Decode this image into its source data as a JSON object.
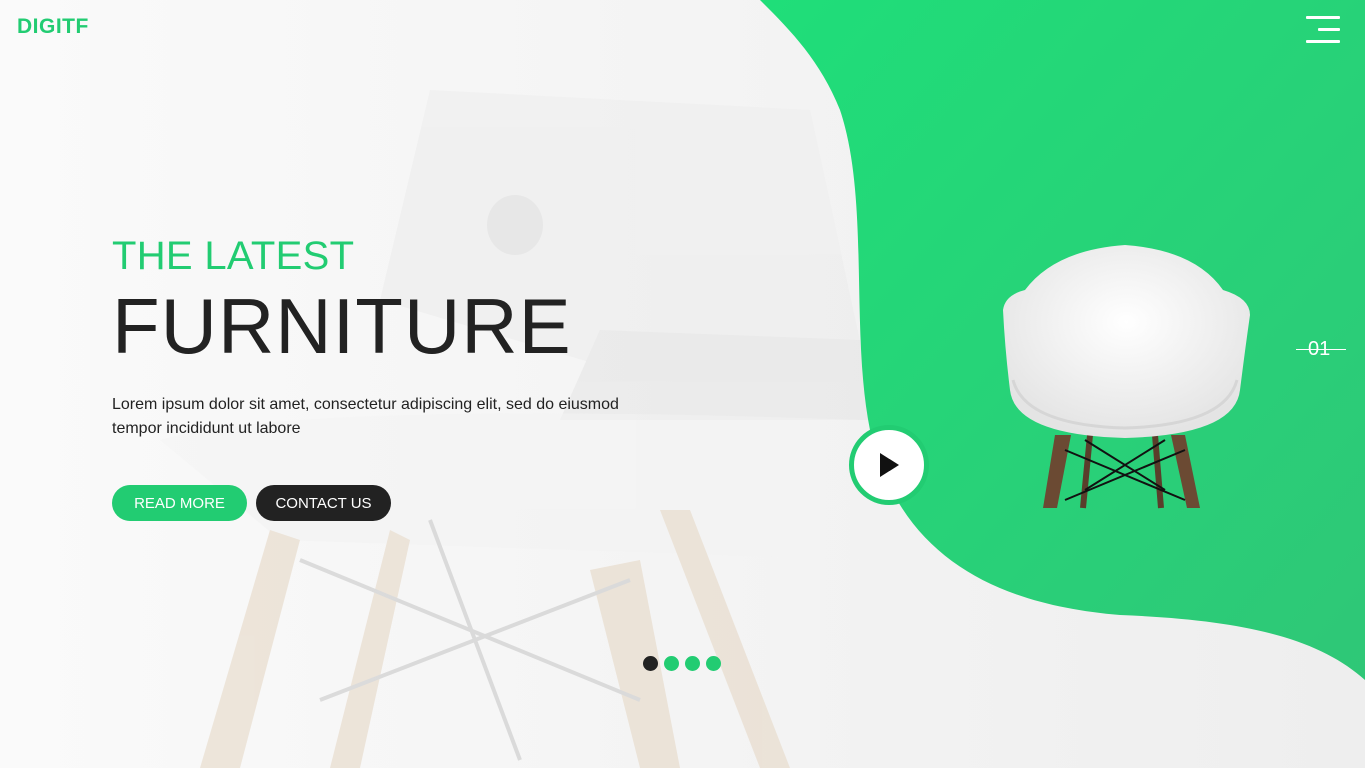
{
  "brand": {
    "logo": "DIGITF"
  },
  "hero": {
    "eyebrow": "THE LATEST",
    "title": "FURNITURE",
    "description": "Lorem ipsum dolor sit amet, consectetur adipiscing elit, sed do eiusmod tempor incididunt ut labore",
    "read_more_label": "READ MORE",
    "contact_label": "CONTACT US"
  },
  "slider": {
    "current": "01",
    "dots": [
      {
        "active": true
      },
      {
        "active": false
      },
      {
        "active": false
      },
      {
        "active": false
      }
    ]
  },
  "colors": {
    "accent": "#22cc72",
    "dark": "#222222",
    "background": "#f6f7f8"
  },
  "icons": {
    "menu": "hamburger-menu-icon",
    "play": "play-icon"
  }
}
